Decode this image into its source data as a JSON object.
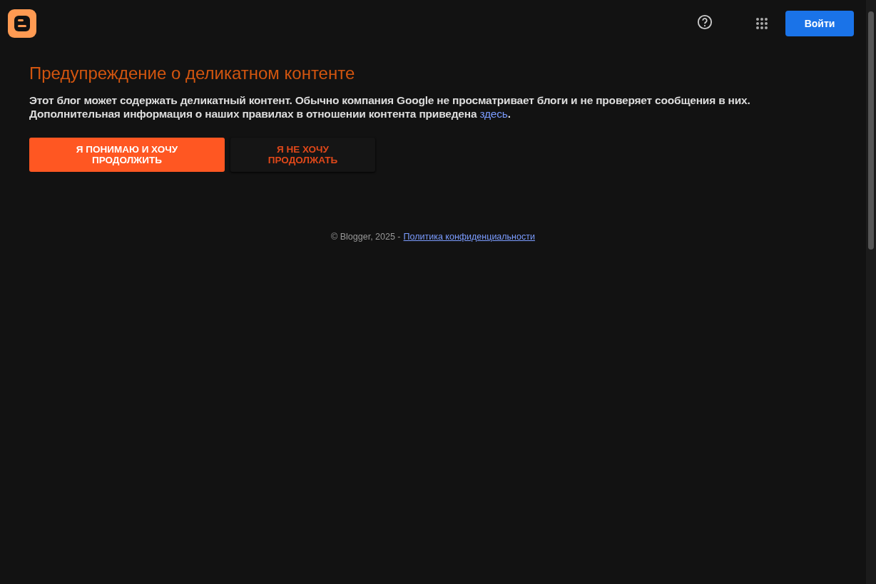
{
  "header": {
    "sign_in": "Войти"
  },
  "warning": {
    "title": "Предупреждение о деликатном контенте",
    "text_line1": "Этот блог может содержать деликатный контент. Обычно компания Google не просматривает блоги и не проверяет сообщения в них.",
    "text_line2": "Дополнительная информация о наших правилах в отношении контента приведена",
    "link": "здесь",
    "text_end": "."
  },
  "buttons": [
    {
      "label": "Я ПОНИМАЮ И ХОЧУ ПРОДОЛЖИТЬ",
      "kind": "primary"
    },
    {
      "label": "Я НЕ ХОЧУ ПРОДОЛЖАТЬ",
      "kind": "secondary"
    }
  ],
  "footer": {
    "copyright": "© Blogger, 2025 -",
    "link": "Политика конфиденциальности"
  }
}
